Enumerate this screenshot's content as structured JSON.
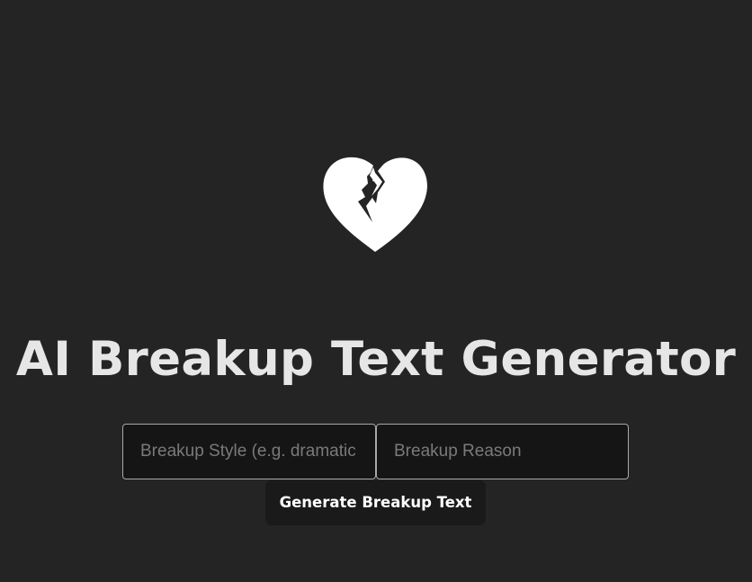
{
  "header": {
    "logo_icon": "broken-heart-icon",
    "title": "AI Breakup Text Generator"
  },
  "form": {
    "style_input": {
      "placeholder": "Breakup Style (e.g. dramatic",
      "value": ""
    },
    "reason_input": {
      "placeholder": "Breakup Reason",
      "value": ""
    },
    "generate_label": "Generate Breakup Text"
  },
  "colors": {
    "background": "#242424",
    "title": "#e6e6e6",
    "input_background": "#151515",
    "input_border": "#a8a8a8",
    "placeholder": "#7a7a7a",
    "button_background": "#1a1a1a",
    "button_text": "#ffffff",
    "icon": "#ffffff"
  }
}
